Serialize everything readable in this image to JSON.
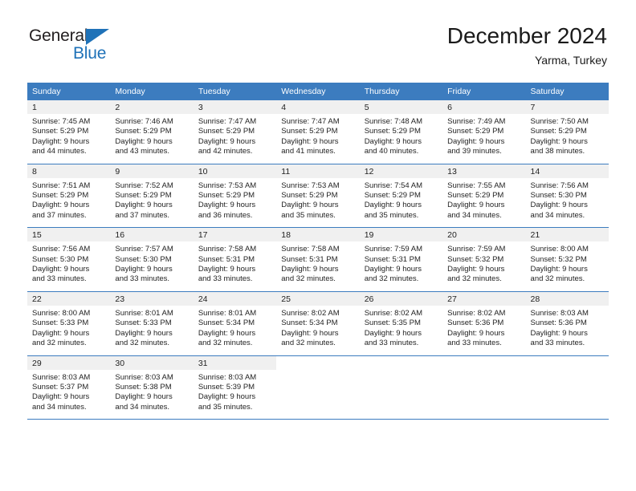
{
  "brand": {
    "name_part1": "General",
    "name_part2": "Blue"
  },
  "header": {
    "title": "December 2024",
    "subtitle": "Yarma, Turkey"
  },
  "colors": {
    "header_blue": "#3c7cbf",
    "brand_blue": "#1f72b8",
    "day_band_gray": "#f0f0f0"
  },
  "calendar": {
    "day_headers": [
      "Sunday",
      "Monday",
      "Tuesday",
      "Wednesday",
      "Thursday",
      "Friday",
      "Saturday"
    ],
    "weeks": [
      [
        {
          "day": "1",
          "sunrise": "Sunrise: 7:45 AM",
          "sunset": "Sunset: 5:29 PM",
          "daylight1": "Daylight: 9 hours",
          "daylight2": "and 44 minutes."
        },
        {
          "day": "2",
          "sunrise": "Sunrise: 7:46 AM",
          "sunset": "Sunset: 5:29 PM",
          "daylight1": "Daylight: 9 hours",
          "daylight2": "and 43 minutes."
        },
        {
          "day": "3",
          "sunrise": "Sunrise: 7:47 AM",
          "sunset": "Sunset: 5:29 PM",
          "daylight1": "Daylight: 9 hours",
          "daylight2": "and 42 minutes."
        },
        {
          "day": "4",
          "sunrise": "Sunrise: 7:47 AM",
          "sunset": "Sunset: 5:29 PM",
          "daylight1": "Daylight: 9 hours",
          "daylight2": "and 41 minutes."
        },
        {
          "day": "5",
          "sunrise": "Sunrise: 7:48 AM",
          "sunset": "Sunset: 5:29 PM",
          "daylight1": "Daylight: 9 hours",
          "daylight2": "and 40 minutes."
        },
        {
          "day": "6",
          "sunrise": "Sunrise: 7:49 AM",
          "sunset": "Sunset: 5:29 PM",
          "daylight1": "Daylight: 9 hours",
          "daylight2": "and 39 minutes."
        },
        {
          "day": "7",
          "sunrise": "Sunrise: 7:50 AM",
          "sunset": "Sunset: 5:29 PM",
          "daylight1": "Daylight: 9 hours",
          "daylight2": "and 38 minutes."
        }
      ],
      [
        {
          "day": "8",
          "sunrise": "Sunrise: 7:51 AM",
          "sunset": "Sunset: 5:29 PM",
          "daylight1": "Daylight: 9 hours",
          "daylight2": "and 37 minutes."
        },
        {
          "day": "9",
          "sunrise": "Sunrise: 7:52 AM",
          "sunset": "Sunset: 5:29 PM",
          "daylight1": "Daylight: 9 hours",
          "daylight2": "and 37 minutes."
        },
        {
          "day": "10",
          "sunrise": "Sunrise: 7:53 AM",
          "sunset": "Sunset: 5:29 PM",
          "daylight1": "Daylight: 9 hours",
          "daylight2": "and 36 minutes."
        },
        {
          "day": "11",
          "sunrise": "Sunrise: 7:53 AM",
          "sunset": "Sunset: 5:29 PM",
          "daylight1": "Daylight: 9 hours",
          "daylight2": "and 35 minutes."
        },
        {
          "day": "12",
          "sunrise": "Sunrise: 7:54 AM",
          "sunset": "Sunset: 5:29 PM",
          "daylight1": "Daylight: 9 hours",
          "daylight2": "and 35 minutes."
        },
        {
          "day": "13",
          "sunrise": "Sunrise: 7:55 AM",
          "sunset": "Sunset: 5:29 PM",
          "daylight1": "Daylight: 9 hours",
          "daylight2": "and 34 minutes."
        },
        {
          "day": "14",
          "sunrise": "Sunrise: 7:56 AM",
          "sunset": "Sunset: 5:30 PM",
          "daylight1": "Daylight: 9 hours",
          "daylight2": "and 34 minutes."
        }
      ],
      [
        {
          "day": "15",
          "sunrise": "Sunrise: 7:56 AM",
          "sunset": "Sunset: 5:30 PM",
          "daylight1": "Daylight: 9 hours",
          "daylight2": "and 33 minutes."
        },
        {
          "day": "16",
          "sunrise": "Sunrise: 7:57 AM",
          "sunset": "Sunset: 5:30 PM",
          "daylight1": "Daylight: 9 hours",
          "daylight2": "and 33 minutes."
        },
        {
          "day": "17",
          "sunrise": "Sunrise: 7:58 AM",
          "sunset": "Sunset: 5:31 PM",
          "daylight1": "Daylight: 9 hours",
          "daylight2": "and 33 minutes."
        },
        {
          "day": "18",
          "sunrise": "Sunrise: 7:58 AM",
          "sunset": "Sunset: 5:31 PM",
          "daylight1": "Daylight: 9 hours",
          "daylight2": "and 32 minutes."
        },
        {
          "day": "19",
          "sunrise": "Sunrise: 7:59 AM",
          "sunset": "Sunset: 5:31 PM",
          "daylight1": "Daylight: 9 hours",
          "daylight2": "and 32 minutes."
        },
        {
          "day": "20",
          "sunrise": "Sunrise: 7:59 AM",
          "sunset": "Sunset: 5:32 PM",
          "daylight1": "Daylight: 9 hours",
          "daylight2": "and 32 minutes."
        },
        {
          "day": "21",
          "sunrise": "Sunrise: 8:00 AM",
          "sunset": "Sunset: 5:32 PM",
          "daylight1": "Daylight: 9 hours",
          "daylight2": "and 32 minutes."
        }
      ],
      [
        {
          "day": "22",
          "sunrise": "Sunrise: 8:00 AM",
          "sunset": "Sunset: 5:33 PM",
          "daylight1": "Daylight: 9 hours",
          "daylight2": "and 32 minutes."
        },
        {
          "day": "23",
          "sunrise": "Sunrise: 8:01 AM",
          "sunset": "Sunset: 5:33 PM",
          "daylight1": "Daylight: 9 hours",
          "daylight2": "and 32 minutes."
        },
        {
          "day": "24",
          "sunrise": "Sunrise: 8:01 AM",
          "sunset": "Sunset: 5:34 PM",
          "daylight1": "Daylight: 9 hours",
          "daylight2": "and 32 minutes."
        },
        {
          "day": "25",
          "sunrise": "Sunrise: 8:02 AM",
          "sunset": "Sunset: 5:34 PM",
          "daylight1": "Daylight: 9 hours",
          "daylight2": "and 32 minutes."
        },
        {
          "day": "26",
          "sunrise": "Sunrise: 8:02 AM",
          "sunset": "Sunset: 5:35 PM",
          "daylight1": "Daylight: 9 hours",
          "daylight2": "and 33 minutes."
        },
        {
          "day": "27",
          "sunrise": "Sunrise: 8:02 AM",
          "sunset": "Sunset: 5:36 PM",
          "daylight1": "Daylight: 9 hours",
          "daylight2": "and 33 minutes."
        },
        {
          "day": "28",
          "sunrise": "Sunrise: 8:03 AM",
          "sunset": "Sunset: 5:36 PM",
          "daylight1": "Daylight: 9 hours",
          "daylight2": "and 33 minutes."
        }
      ],
      [
        {
          "day": "29",
          "sunrise": "Sunrise: 8:03 AM",
          "sunset": "Sunset: 5:37 PM",
          "daylight1": "Daylight: 9 hours",
          "daylight2": "and 34 minutes."
        },
        {
          "day": "30",
          "sunrise": "Sunrise: 8:03 AM",
          "sunset": "Sunset: 5:38 PM",
          "daylight1": "Daylight: 9 hours",
          "daylight2": "and 34 minutes."
        },
        {
          "day": "31",
          "sunrise": "Sunrise: 8:03 AM",
          "sunset": "Sunset: 5:39 PM",
          "daylight1": "Daylight: 9 hours",
          "daylight2": "and 35 minutes."
        },
        {
          "day": "",
          "sunrise": "",
          "sunset": "",
          "daylight1": "",
          "daylight2": ""
        },
        {
          "day": "",
          "sunrise": "",
          "sunset": "",
          "daylight1": "",
          "daylight2": ""
        },
        {
          "day": "",
          "sunrise": "",
          "sunset": "",
          "daylight1": "",
          "daylight2": ""
        },
        {
          "day": "",
          "sunrise": "",
          "sunset": "",
          "daylight1": "",
          "daylight2": ""
        }
      ]
    ]
  }
}
